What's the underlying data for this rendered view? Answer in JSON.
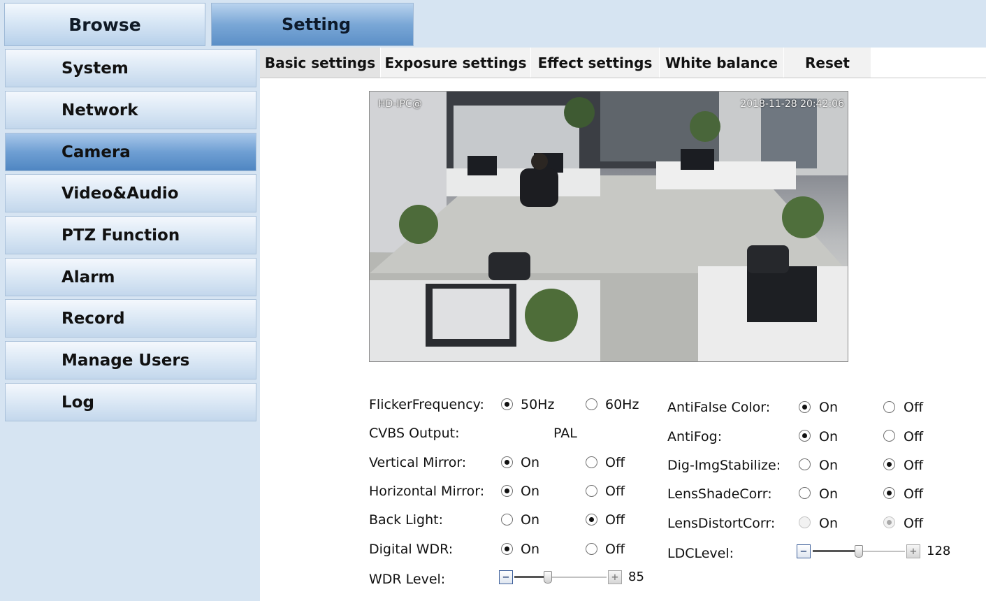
{
  "top_tabs": {
    "browse": "Browse",
    "setting": "Setting"
  },
  "sidebar": {
    "items": [
      {
        "label": "System",
        "active": false
      },
      {
        "label": "Network",
        "active": false
      },
      {
        "label": "Camera",
        "active": true
      },
      {
        "label": "Video&Audio",
        "active": false
      },
      {
        "label": "PTZ Function",
        "active": false
      },
      {
        "label": "Alarm",
        "active": false
      },
      {
        "label": "Record",
        "active": false
      },
      {
        "label": "Manage Users",
        "active": false
      },
      {
        "label": "Log",
        "active": false
      }
    ]
  },
  "sub_tabs": [
    {
      "label": "Basic settings",
      "active": true
    },
    {
      "label": "Exposure settings",
      "active": false
    },
    {
      "label": "Effect settings",
      "active": false
    },
    {
      "label": "White balance",
      "active": false
    },
    {
      "label": "Reset",
      "active": false
    }
  ],
  "video": {
    "osd_name": "HD-IPC@",
    "osd_time": "2018-11-28  20:42:06"
  },
  "form_left": {
    "flicker": {
      "label": "FlickerFrequency:",
      "opt1": "50Hz",
      "opt2": "60Hz",
      "selected": "50Hz"
    },
    "cvbs": {
      "label": "CVBS Output:",
      "value": "PAL"
    },
    "vmirror": {
      "label": "Vertical Mirror:",
      "opt1": "On",
      "opt2": "Off",
      "selected": "On"
    },
    "hmirror": {
      "label": "Horizontal Mirror:",
      "opt1": "On",
      "opt2": "Off",
      "selected": "On"
    },
    "backlight": {
      "label": "Back Light:",
      "opt1": "On",
      "opt2": "Off",
      "selected": "Off"
    },
    "dwdr": {
      "label": "Digital WDR:",
      "opt1": "On",
      "opt2": "Off",
      "selected": "On"
    },
    "wdr_level": {
      "label": "WDR Level:",
      "value": "85",
      "fraction": 0.35,
      "minus": "−",
      "plus": "+"
    }
  },
  "form_right": {
    "antifalse": {
      "label": "AntiFalse Color:",
      "opt1": "On",
      "opt2": "Off",
      "selected": "On"
    },
    "antifog": {
      "label": "AntiFog:",
      "opt1": "On",
      "opt2": "Off",
      "selected": "On"
    },
    "digstab": {
      "label": "Dig-ImgStabilize:",
      "opt1": "On",
      "opt2": "Off",
      "selected": "Off"
    },
    "lensshade": {
      "label": "LensShadeCorr:",
      "opt1": "On",
      "opt2": "Off",
      "selected": "Off"
    },
    "lensdistort": {
      "label": "LensDistortCorr:",
      "opt1": "On",
      "opt2": "Off",
      "selected": "Off",
      "disabled": true
    },
    "ldc_level": {
      "label": "LDCLevel:",
      "value": "128",
      "fraction": 0.5,
      "minus": "−",
      "plus": "+"
    }
  }
}
